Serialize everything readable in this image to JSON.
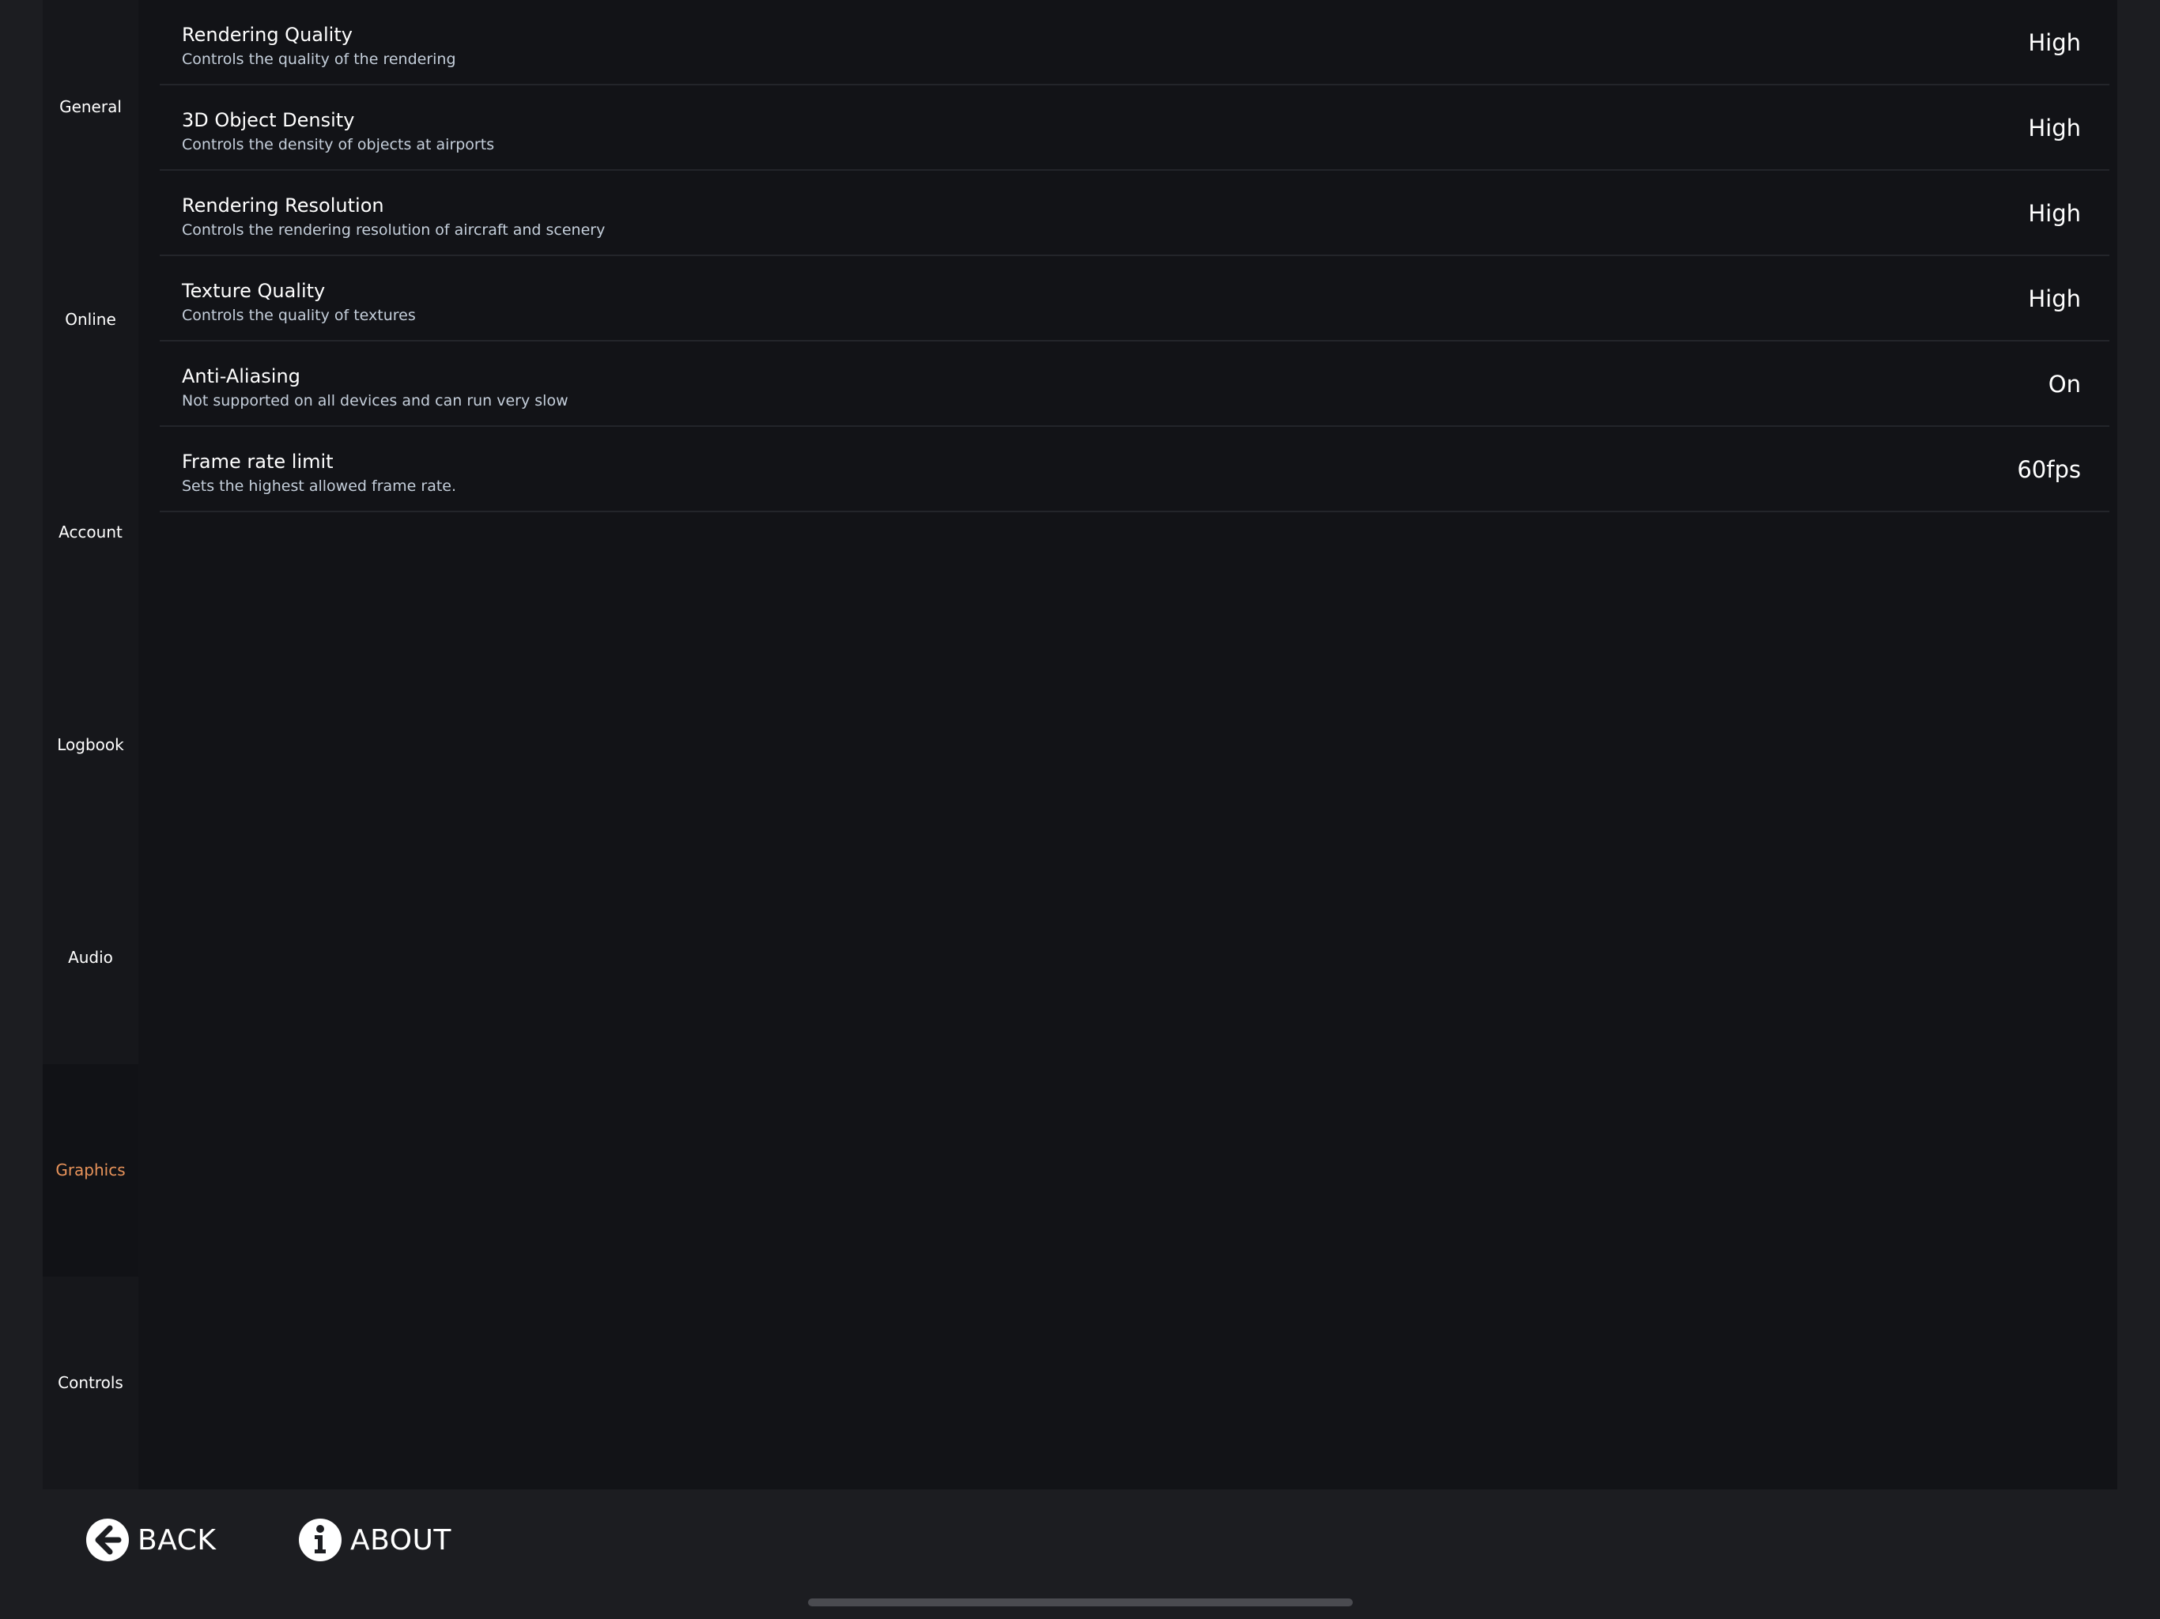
{
  "sidebar": {
    "items": [
      {
        "label": "General",
        "active": false
      },
      {
        "label": "Online",
        "active": false
      },
      {
        "label": "Account",
        "active": false
      },
      {
        "label": "Logbook",
        "active": false
      },
      {
        "label": "Audio",
        "active": false
      },
      {
        "label": "Graphics",
        "active": true
      },
      {
        "label": "Controls",
        "active": false
      }
    ]
  },
  "settings": [
    {
      "title": "Rendering Quality",
      "description": "Controls the quality of the rendering",
      "value": "High"
    },
    {
      "title": "3D Object Density",
      "description": "Controls the density of objects at airports",
      "value": "High"
    },
    {
      "title": "Rendering Resolution",
      "description": "Controls the rendering resolution of aircraft and scenery",
      "value": "High"
    },
    {
      "title": "Texture Quality",
      "description": "Controls the quality of textures",
      "value": "High"
    },
    {
      "title": "Anti-Aliasing",
      "description": "Not supported on all devices and can run very slow",
      "value": "On"
    },
    {
      "title": "Frame rate limit",
      "description": "Sets the highest allowed frame rate.",
      "value": "60fps"
    }
  ],
  "footer": {
    "back_label": "BACK",
    "about_label": "ABOUT"
  },
  "colors": {
    "accent": "#e8935a",
    "background": "#1c1d21",
    "panel": "#121317",
    "sidebar": "#16171b",
    "divider": "#23252a",
    "description_text": "#c5cfdb"
  },
  "icons": {
    "back": "arrow-left-circle-icon",
    "about": "info-circle-icon"
  }
}
